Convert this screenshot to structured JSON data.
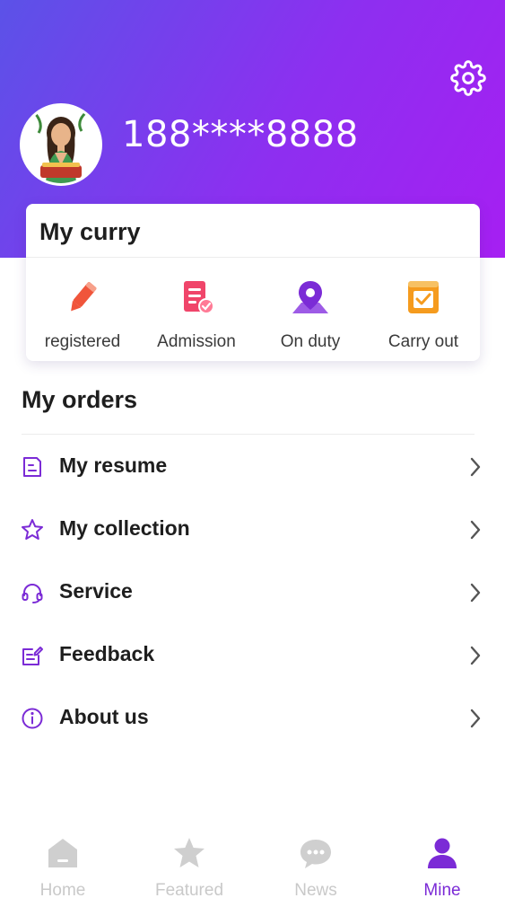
{
  "profile": {
    "username": "188****8888"
  },
  "card": {
    "title": "My curry",
    "items": [
      {
        "label": "registered",
        "icon": "pencil-icon",
        "color": "#f0553b"
      },
      {
        "label": "Admission",
        "icon": "admission-doc-icon",
        "color": "#f0456a"
      },
      {
        "label": "On duty",
        "icon": "location-pin-icon",
        "color": "#7b2bd6"
      },
      {
        "label": "Carry out",
        "icon": "checkbox-done-icon",
        "color": "#f59b1e"
      }
    ]
  },
  "orders": {
    "title": "My orders",
    "items": [
      {
        "label": "My resume",
        "icon": "resume-icon"
      },
      {
        "label": "My collection",
        "icon": "star-outline-icon"
      },
      {
        "label": "Service",
        "icon": "headset-icon"
      },
      {
        "label": "Feedback",
        "icon": "edit-note-icon"
      },
      {
        "label": "About us",
        "icon": "info-icon"
      }
    ]
  },
  "tabs": [
    {
      "label": "Home",
      "icon": "home-icon",
      "active": false
    },
    {
      "label": "Featured",
      "icon": "star-icon",
      "active": false
    },
    {
      "label": "News",
      "icon": "chat-bubble-icon",
      "active": false
    },
    {
      "label": "Mine",
      "icon": "person-icon",
      "active": true
    }
  ],
  "colors": {
    "accent": "#7b2bd6",
    "header_gradient_start": "#5b52e8",
    "header_gradient_end": "#a61ff2",
    "inactive_tab": "#c9c9c9"
  }
}
